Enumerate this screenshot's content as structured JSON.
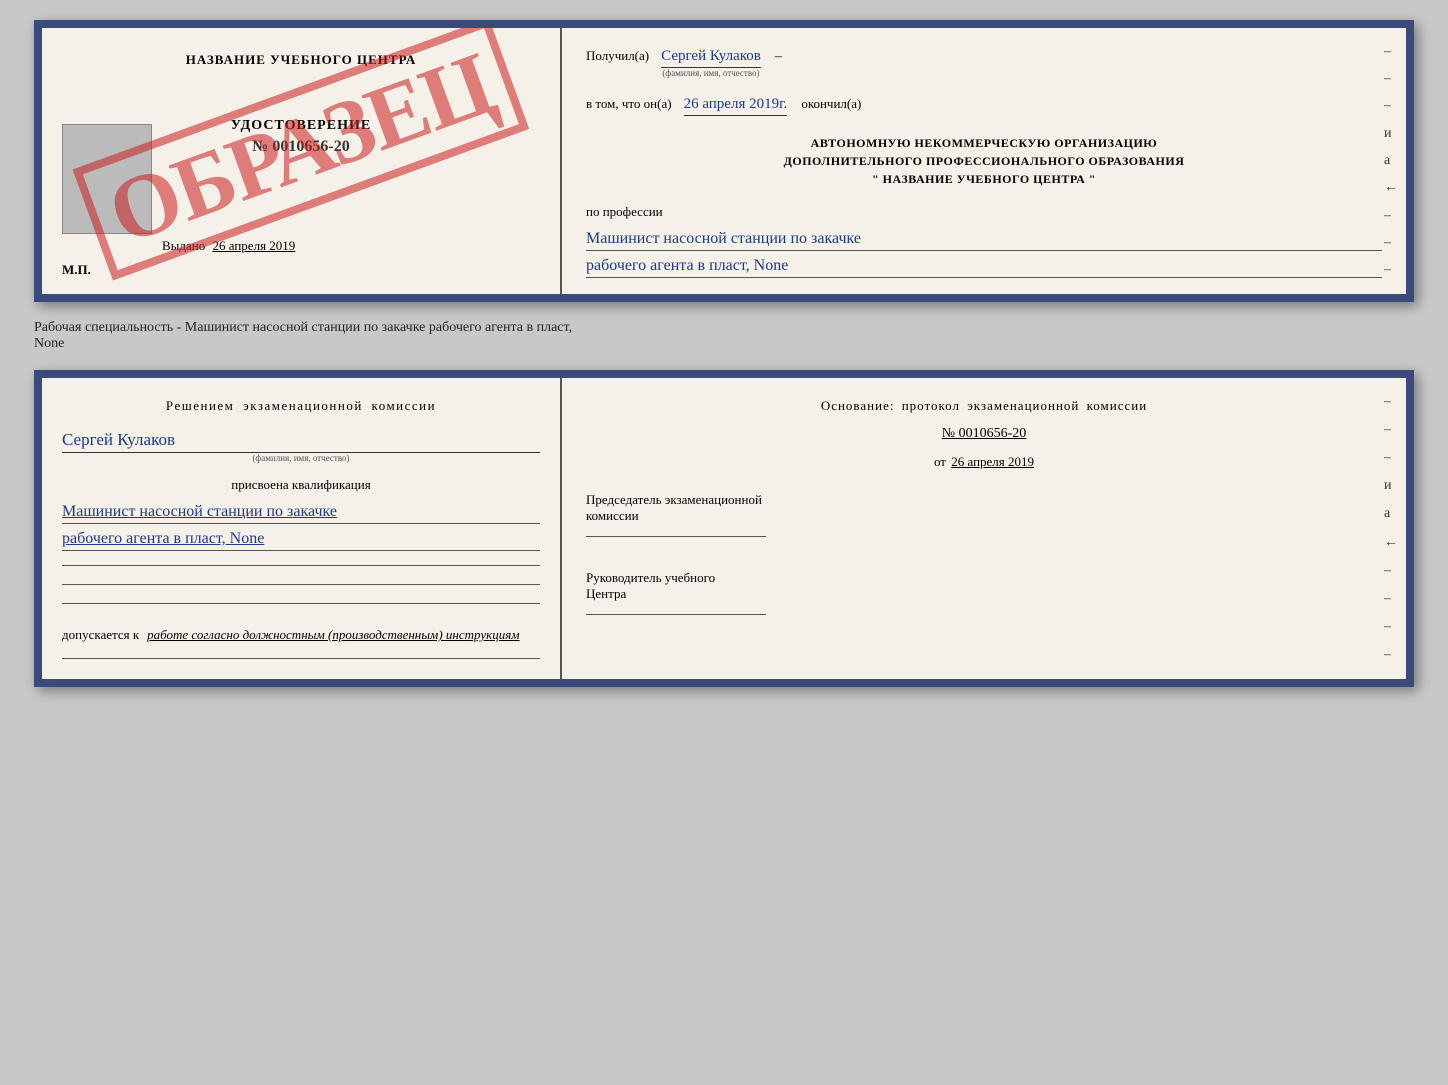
{
  "top_doc": {
    "left": {
      "title": "НАЗВАНИЕ УЧЕБНОГО ЦЕНТРА",
      "stamp": "ОБРАЗЕЦ",
      "cert_title": "УДОСТОВЕРЕНИЕ",
      "cert_number": "№ 0010656-20",
      "vydano_label": "Выдано",
      "vydano_date": "26 апреля 2019",
      "mp": "М.П."
    },
    "right": {
      "poluchil_label": "Получил(а)",
      "poluchil_name": "Сергей Кулаков",
      "name_sublabel": "(фамилия, имя, отчество)",
      "dash1": "–",
      "vtom_label": "в том, что он(а)",
      "vtom_date": "26 апреля 2019г.",
      "okonchil_label": "окончил(а)",
      "org_line1": "АВТОНОМНУЮ НЕКОММЕРЧЕСКУЮ ОРГАНИЗАЦИЮ",
      "org_line2": "ДОПОЛНИТЕЛЬНОГО ПРОФЕССИОНАЛЬНОГО ОБРАЗОВАНИЯ",
      "org_line3": "\"  НАЗВАНИЕ УЧЕБНОГО ЦЕНТРА  \"",
      "po_professii": "по профессии",
      "profession_line1": "Машинист насосной станции по закачке",
      "profession_line2": "рабочего агента в пласт, None",
      "dashes": [
        "-",
        "-",
        "-",
        "и",
        "а",
        "←",
        "-",
        "-",
        "-"
      ]
    }
  },
  "middle": {
    "text": "Рабочая специальность - Машинист насосной станции по закачке рабочего агента в пласт,",
    "text2": "None"
  },
  "bottom_doc": {
    "left": {
      "resheniem_text": "Решением экзаменационной комиссии",
      "name": "Сергей Кулаков",
      "name_sublabel": "(фамилия, имя, отчество)",
      "prisvoena": "присвоена квалификация",
      "qual_line1": "Машинист насосной станции по закачке",
      "qual_line2": "рабочего агента в пласт, None",
      "dopuskaetsya": "допускается к",
      "dopusk_text": "работе согласно должностным (производственным) инструкциям"
    },
    "right": {
      "osnovanie_label": "Основание: протокол экзаменационной комиссии",
      "number": "№ 0010656-20",
      "ot_label": "от",
      "ot_date": "26 апреля 2019",
      "predsedatel_line1": "Председатель экзаменационной",
      "predsedatel_line2": "комиссии",
      "rukovoditel_line1": "Руководитель учебного",
      "rukovoditel_line2": "Центра",
      "dashes": [
        "-",
        "-",
        "-",
        "и",
        "а",
        "←",
        "-",
        "-",
        "-",
        "-"
      ]
    }
  }
}
